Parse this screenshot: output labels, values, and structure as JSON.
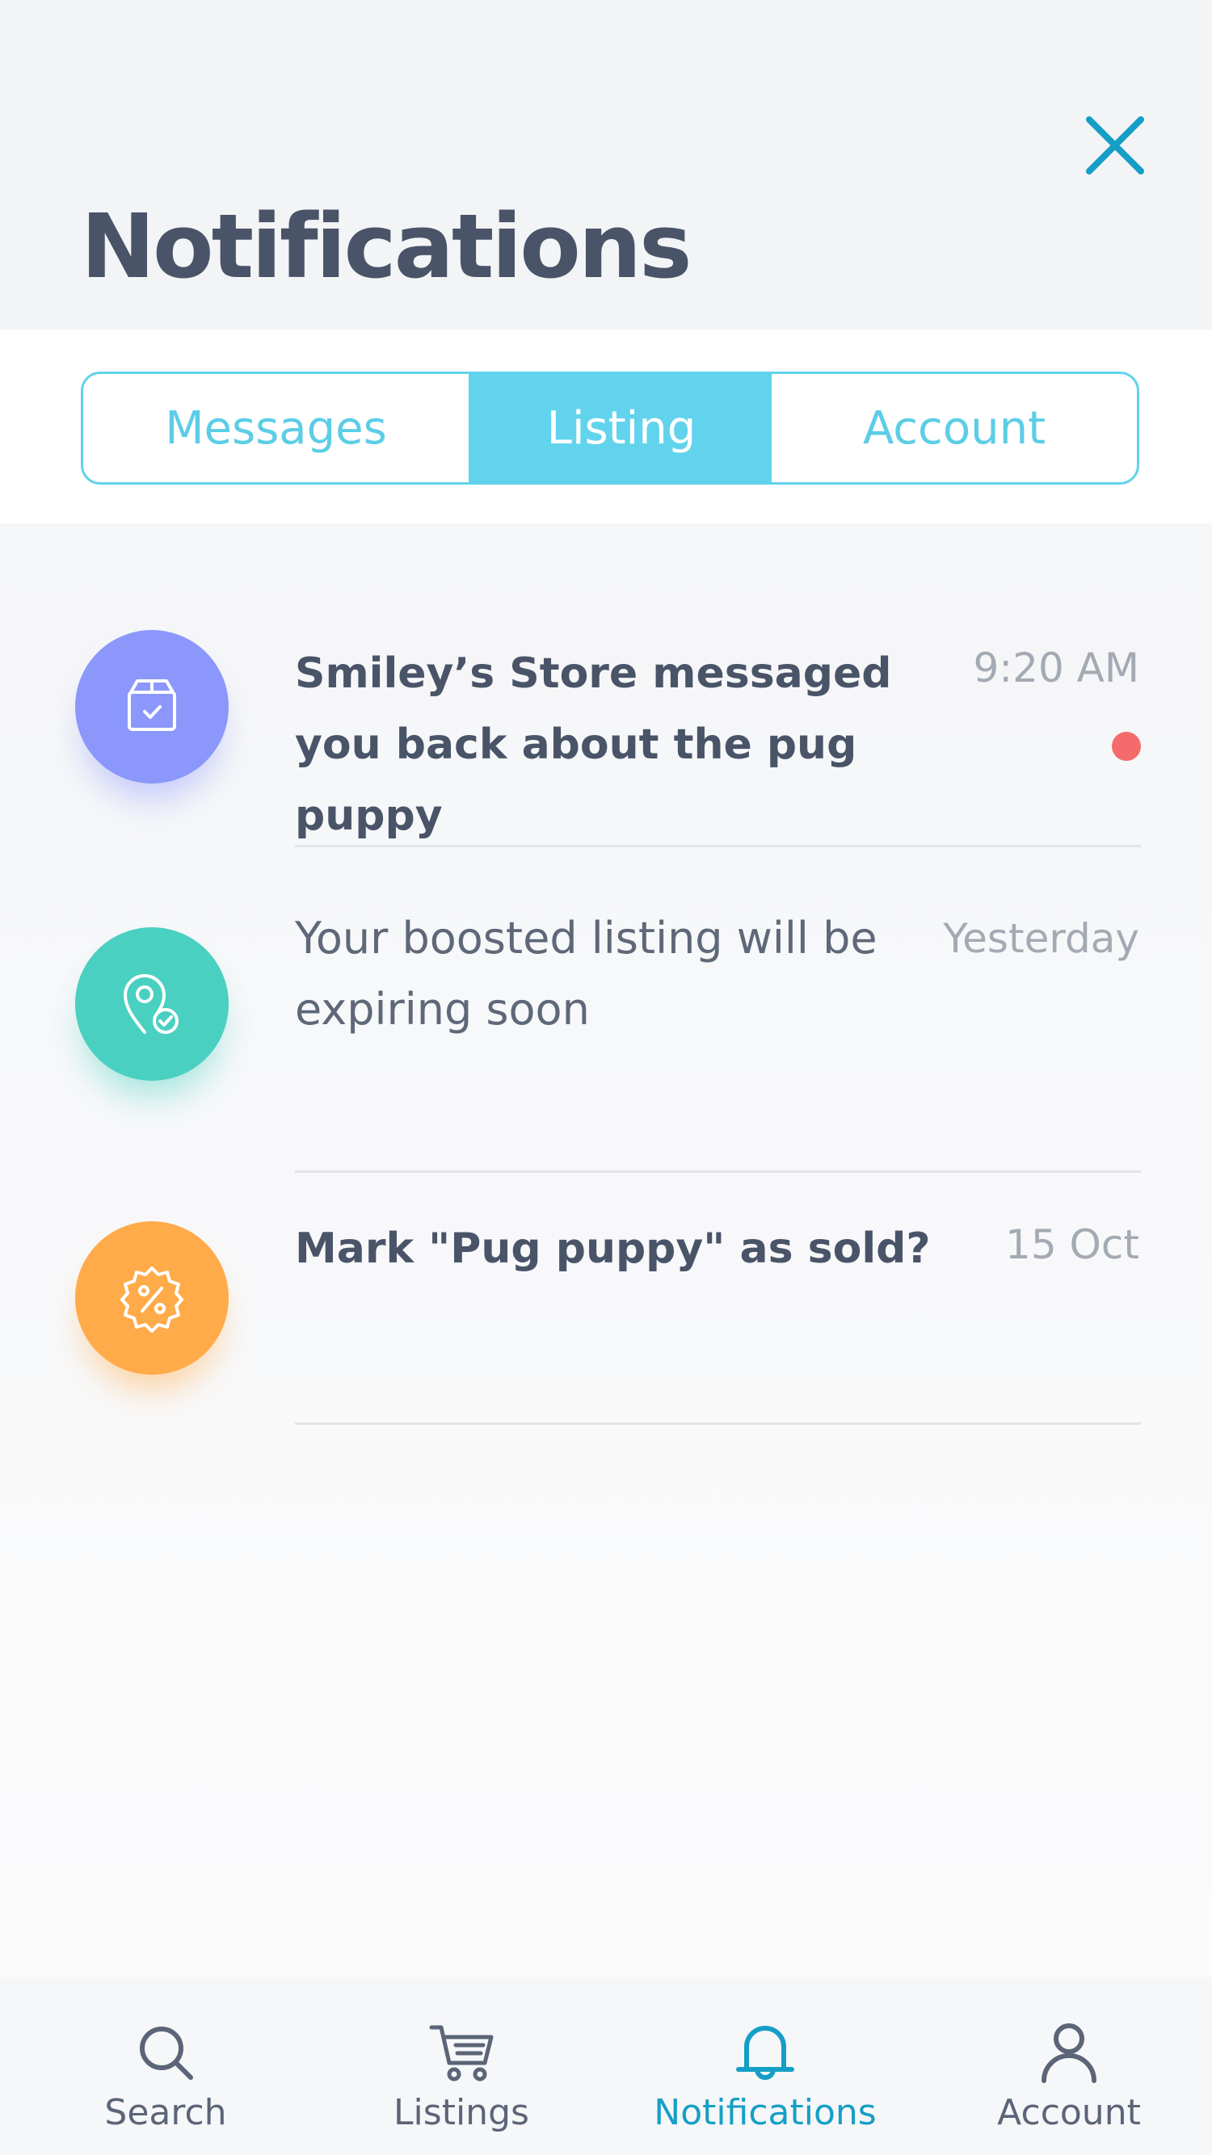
{
  "header": {
    "title": "Notifications",
    "close_icon": "close-icon"
  },
  "tabs": [
    {
      "label": "Messages",
      "selected": false
    },
    {
      "label": "Listing",
      "selected": true
    },
    {
      "label": "Account",
      "selected": false
    }
  ],
  "notifications": [
    {
      "text": "Smiley’s Store messaged you back about the pug puppy",
      "time": "9:20 AM",
      "unread": true,
      "icon": "package-check-icon",
      "color": "#8b97fb",
      "bold": true
    },
    {
      "text": "Your boosted listing will be expiring soon",
      "time": "Yesterday",
      "unread": false,
      "icon": "location-pin-check-icon",
      "color": "#49d0c0",
      "bold": false
    },
    {
      "text": "Mark \"Pug puppy\" as sold?",
      "time": "15 Oct",
      "unread": false,
      "icon": "discount-badge-icon",
      "color": "#ffab4a",
      "bold": true
    }
  ],
  "bottom_nav": [
    {
      "label": "Search",
      "icon": "search-icon",
      "active": false
    },
    {
      "label": "Listings",
      "icon": "cart-icon",
      "active": false
    },
    {
      "label": "Notifications",
      "icon": "bell-icon",
      "active": true
    },
    {
      "label": "Account",
      "icon": "user-icon",
      "active": false
    }
  ],
  "colors": {
    "accent": "#62d3ec",
    "active_nav": "#169fc6",
    "close_icon": "#169fc6",
    "title": "#4a5468",
    "unread_dot": "#f56b6b"
  }
}
